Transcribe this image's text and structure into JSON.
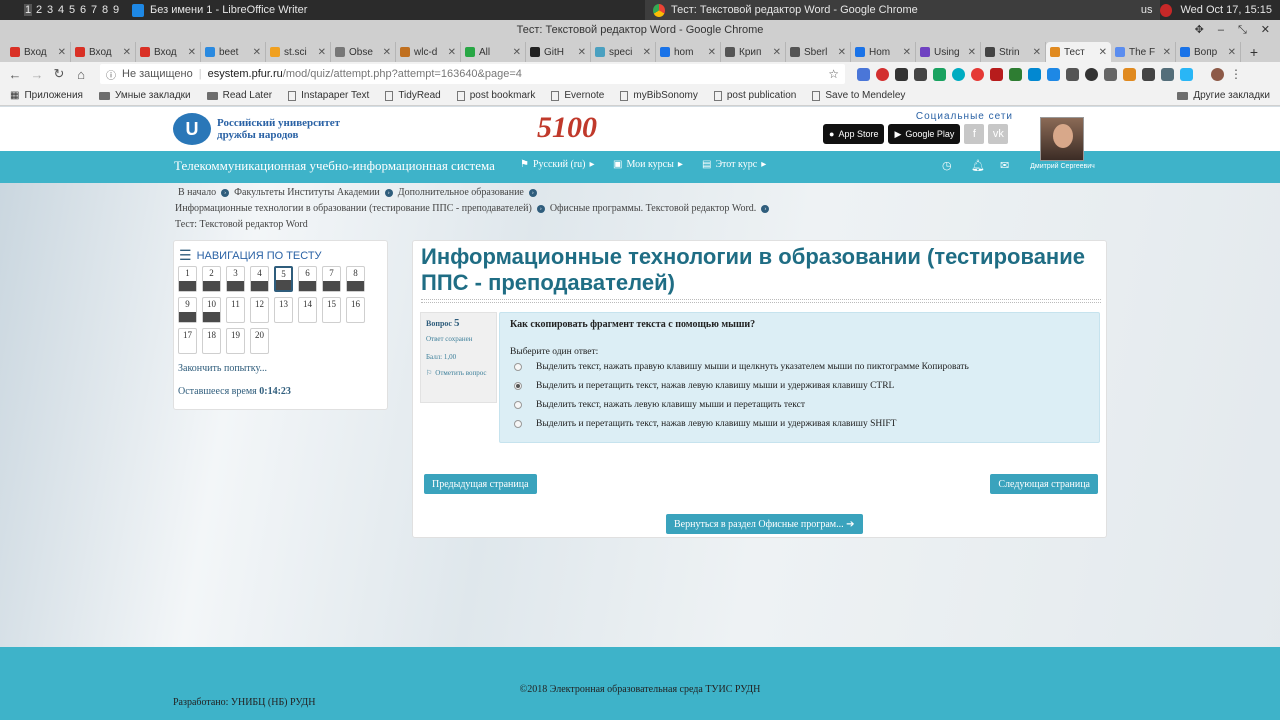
{
  "system": {
    "workspaces": [
      "1",
      "2",
      "3",
      "4",
      "5",
      "6",
      "7",
      "8",
      "9"
    ],
    "writer_title": "Без имени 1 - LibreOffice Writer",
    "chrome_title": "Тест: Текстовой редактор Word - Google Chrome",
    "keyboard": "us",
    "clock": "Wed Oct 17, 15:15"
  },
  "window": {
    "title": "Тест: Текстовой редактор Word - Google Chrome"
  },
  "tabs": [
    {
      "label": "Вход",
      "color": "#d93025"
    },
    {
      "label": "Вход",
      "color": "#d93025"
    },
    {
      "label": "Вход",
      "color": "#d93025"
    },
    {
      "label": "beet",
      "color": "#2a8ae0"
    },
    {
      "label": "st.sci",
      "color": "#f0a020"
    },
    {
      "label": "Obse",
      "color": "#777777"
    },
    {
      "label": "wlc-d",
      "color": "#c07020"
    },
    {
      "label": "All",
      "color": "#28a745"
    },
    {
      "label": "GitH",
      "color": "#222222"
    },
    {
      "label": "speci",
      "color": "#4aa0c0"
    },
    {
      "label": "hom",
      "color": "#1a73e8"
    },
    {
      "label": "Крип",
      "color": "#555555"
    },
    {
      "label": "Sberl",
      "color": "#555555"
    },
    {
      "label": "Hom",
      "color": "#1a73e8"
    },
    {
      "label": "Using",
      "color": "#6f42c1"
    },
    {
      "label": "Strin",
      "color": "#444444"
    },
    {
      "label": "Тест",
      "color": "#e08a20"
    },
    {
      "label": "The F",
      "color": "#5b8def"
    },
    {
      "label": "Вопр",
      "color": "#1a73e8"
    }
  ],
  "active_tab_index": 16,
  "nav": {
    "not_secure": "Не защищено",
    "url_host": "esystem.pfur.ru",
    "url_path": "/mod/quiz/attempt.php?attempt=163640&page=4"
  },
  "bookmarks": [
    "Приложения",
    "Умные закладки",
    "Read Later",
    "Instapaper Text",
    "TidyRead",
    "post bookmark",
    "Evernote",
    "myBibSonomy",
    "post publication",
    "Save to Mendeley"
  ],
  "other_bookmarks": "Другие закладки",
  "header": {
    "uni_line1": "Российский университет",
    "uni_line2": "дружбы народов",
    "logo_5100": "5100",
    "social_label": "Социальные сети",
    "app_store": "App Store",
    "google_play": "Google Play"
  },
  "topnav": {
    "site": "Телекоммуникационная учебно-информационная система",
    "lang": "Русский (ru)",
    "courses": "Мои курсы",
    "course": "Этот курс",
    "user": "Дмитрий Сергеевич"
  },
  "breadcrumbs": {
    "row1": [
      "В начало",
      "Факультеты Институты Академии",
      "Дополнительное образование"
    ],
    "row2": [
      "Информационные технологии в образовании (тестирование ППС - преподавателей)",
      "Офисные программы. Текстовой редактор Word."
    ],
    "row3": "Тест: Текстовой редактор Word"
  },
  "quiznav": {
    "title": "НАВИГАЦИЯ ПО ТЕСТУ",
    "finish": "Закончить попытку...",
    "time_label": "Оставшееся время",
    "time_value": "0:14:23",
    "questions": [
      {
        "n": "1",
        "answered": true
      },
      {
        "n": "2",
        "answered": true
      },
      {
        "n": "3",
        "answered": true
      },
      {
        "n": "4",
        "answered": true
      },
      {
        "n": "5",
        "answered": true,
        "current": true
      },
      {
        "n": "6",
        "answered": true
      },
      {
        "n": "7",
        "answered": true
      },
      {
        "n": "8",
        "answered": true
      },
      {
        "n": "9",
        "answered": true
      },
      {
        "n": "10",
        "answered": true
      },
      {
        "n": "11",
        "answered": false
      },
      {
        "n": "12",
        "answered": false
      },
      {
        "n": "13",
        "answered": false
      },
      {
        "n": "14",
        "answered": false
      },
      {
        "n": "15",
        "answered": false
      },
      {
        "n": "16",
        "answered": false
      },
      {
        "n": "17",
        "answered": false
      },
      {
        "n": "18",
        "answered": false
      },
      {
        "n": "19",
        "answered": false
      },
      {
        "n": "20",
        "answered": false
      }
    ]
  },
  "main": {
    "title": "Информационные технологии в образовании (тестирование ППС - преподавателей)"
  },
  "question": {
    "label": "Вопрос",
    "number": "5",
    "status": "Ответ сохранен",
    "score": "Балл: 1,00",
    "flag": "Отметить вопрос",
    "text": "Как скопировать фрагмент текста с помощью мыши?",
    "pick": "Выберите один ответ:",
    "options": [
      {
        "text": "Выделить текст, нажать правую клавишу мыши и щелкнуть указателем мыши по пиктограмме Копировать",
        "selected": false
      },
      {
        "text": "Выделить и перетащить текст, нажав левую клавишу мыши и удерживая клавишу CTRL",
        "selected": true
      },
      {
        "text": "Выделить текст, нажать левую клавишу мыши и перетащить текст",
        "selected": false
      },
      {
        "text": "Выделить и перетащить текст, нажав левую клавишу мыши и удерживая клавишу SHIFT",
        "selected": false
      }
    ]
  },
  "buttons": {
    "prev": "Предыдущая страница",
    "next": "Следующая страница",
    "back": "Вернуться в раздел Офисные програм..."
  },
  "footer": {
    "copyright": "©2018 Электронная образовательная среда ТУИС РУДН",
    "developed": "Разработано: УНИБЦ (НБ) РУДН"
  }
}
